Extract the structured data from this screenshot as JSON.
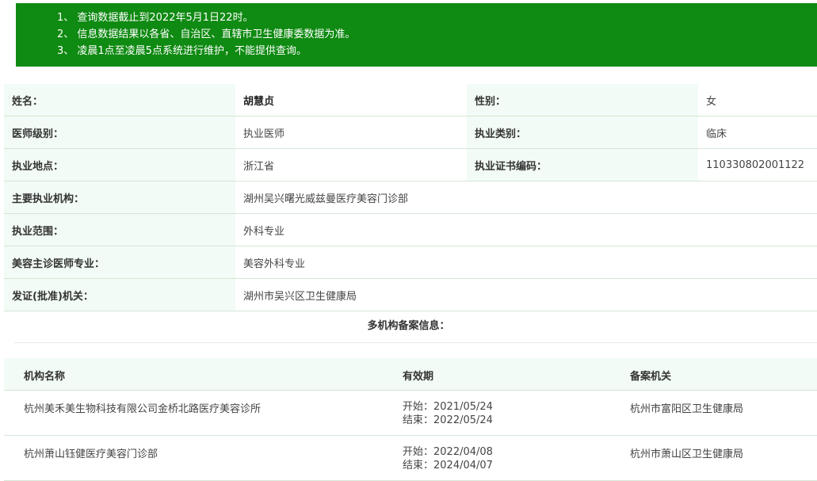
{
  "notice": {
    "lines": [
      "1、 查询数据截止到2022年5月1日22时。",
      "2、 信息数据结果以各省、自治区、直辖市卫生健康委数据为准。",
      "3、 凌晨1点至凌晨5点系统进行维护，不能提供查询。"
    ],
    "background": "#0f8a12"
  },
  "doctor": {
    "name_label": "姓名：",
    "name": "胡慧贞",
    "gender_label": "性别：",
    "gender": "女",
    "level_label": "医师级别：",
    "level": "执业医师",
    "category_label": "执业类别：",
    "category": "临床",
    "location_label": "执业地点：",
    "location": "浙江省",
    "cert_label": "执业证书编码：",
    "cert": "110330802001122",
    "org_label": "主要执业机构：",
    "org": "湖州吴兴曙光威兹曼医疗美容门诊部",
    "scope_label": "执业范围：",
    "scope": "外科专业",
    "cosmetic_label": "美容主诊医师专业：",
    "cosmetic": "美容外科专业",
    "issuer_label": "发证(批准)机关：",
    "issuer": "湖州市吴兴区卫生健康局"
  },
  "multi_org": {
    "title": "多机构备案信息：",
    "headers": [
      "机构名称",
      "有效期",
      "备案机关"
    ],
    "rows": [
      {
        "name": "杭州美禾美生物科技有限公司金桥北路医疗美容诊所",
        "start": "开始：2021/05/24",
        "end": "结束：2022/05/24",
        "authority": "杭州市富阳区卫生健康局"
      },
      {
        "name": "杭州萧山钰健医疗美容门诊部",
        "start": "开始：2022/04/08",
        "end": "结束：2024/04/07",
        "authority": "杭州市萧山区卫生健康局"
      }
    ]
  }
}
